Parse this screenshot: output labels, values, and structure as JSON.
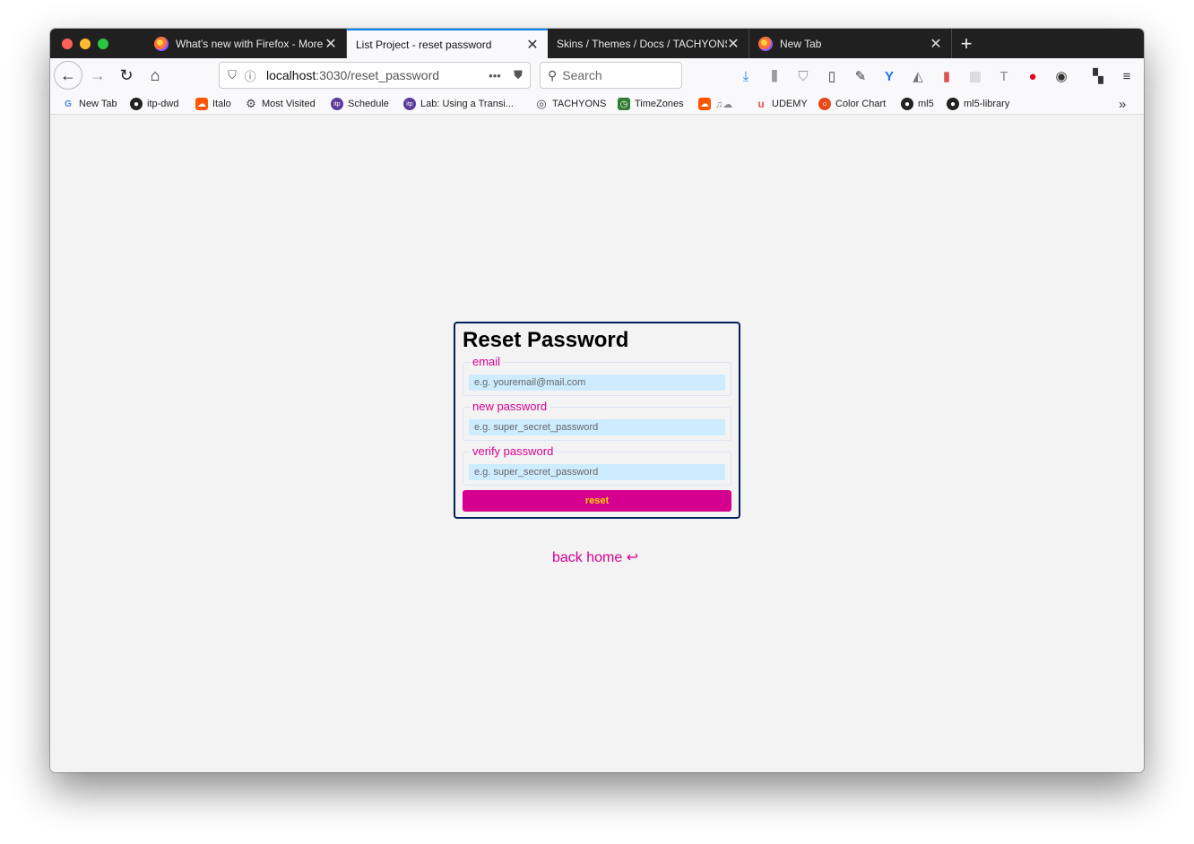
{
  "colors": {
    "accent": "#d5008f",
    "button_text": "#ffd700",
    "input_bg": "#cdecff",
    "card_border": "#00205b",
    "page_bg": "#f3f3f4",
    "tabbar_bg": "#202020"
  },
  "tabs": [
    {
      "label": "What's new with Firefox - More",
      "icon": "firefox-icon"
    },
    {
      "label": "List Project - reset password",
      "icon": "none",
      "active": true
    },
    {
      "label": "Skins / Themes / Docs / TACHYONS",
      "icon": "none"
    },
    {
      "label": "New Tab",
      "icon": "firefox-icon"
    }
  ],
  "url": {
    "host": "localhost",
    "path": ":3030/reset_password"
  },
  "search": {
    "placeholder": "Search"
  },
  "bookmarks": [
    {
      "label": "New Tab",
      "icon": "google-icon"
    },
    {
      "label": "itp-dwd",
      "icon": "github-icon"
    },
    {
      "label": "Italo",
      "icon": "soundcloud-icon"
    },
    {
      "label": "Most Visited",
      "icon": "gear-icon"
    },
    {
      "label": "Schedule",
      "icon": "itp-icon"
    },
    {
      "label": "Lab: Using a Transi...",
      "icon": "itp-icon"
    },
    {
      "label": "TACHYONS",
      "icon": "globe-icon"
    },
    {
      "label": "TimeZones",
      "icon": "timezones-icon"
    },
    {
      "label": "",
      "icon": "soundcloud-icon"
    },
    {
      "label": "UDEMY",
      "icon": "udemy-icon"
    },
    {
      "label": "Color Chart",
      "icon": "color-chart-icon"
    },
    {
      "label": "ml5",
      "icon": "github-icon"
    },
    {
      "label": "ml5-library",
      "icon": "github-icon"
    }
  ],
  "form": {
    "title": "Reset Password",
    "fields": [
      {
        "label": "email",
        "placeholder": "e.g. youremail@mail.com"
      },
      {
        "label": "new password",
        "placeholder": "e.g. super_secret_password"
      },
      {
        "label": "verify password",
        "placeholder": "e.g. super_secret_password"
      }
    ],
    "submit_label": "reset"
  },
  "back_home": {
    "label": "back home",
    "icon": "return-arrow-icon",
    "glyph": "↩"
  }
}
